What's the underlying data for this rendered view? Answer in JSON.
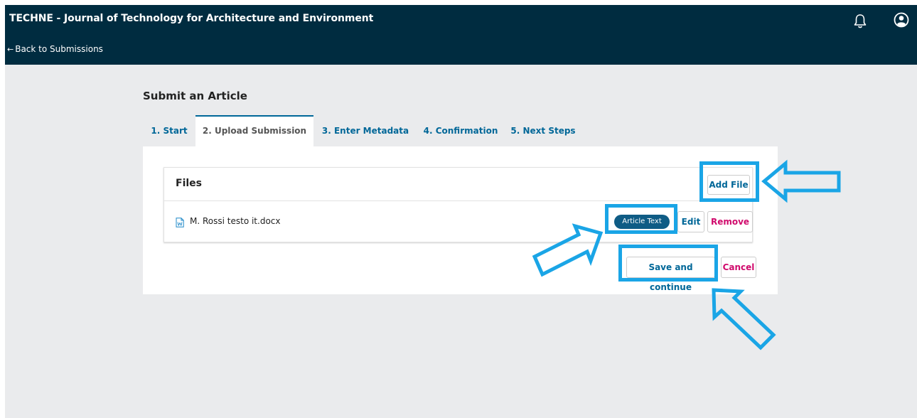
{
  "header": {
    "site_title": "TECHNE - Journal of Technology for Architecture and Environment",
    "back_link": "Back to Submissions",
    "back_arrow": "←"
  },
  "page": {
    "heading": "Submit an Article"
  },
  "tabs": [
    {
      "label": "1. Start",
      "active": false
    },
    {
      "label": "2. Upload Submission",
      "active": true
    },
    {
      "label": "3. Enter Metadata",
      "active": false
    },
    {
      "label": "4. Confirmation",
      "active": false
    },
    {
      "label": "5. Next Steps",
      "active": false
    }
  ],
  "files": {
    "title": "Files",
    "add_file_label": "Add File",
    "items": [
      {
        "name": "M. Rossi testo it.docx",
        "type_badge": "Article Text",
        "edit_label": "Edit",
        "remove_label": "Remove"
      }
    ]
  },
  "actions": {
    "save_label": "Save and continue",
    "cancel_label": "Cancel"
  },
  "colors": {
    "header_bg": "#002c40",
    "link": "#006798",
    "danger": "#d00a6c",
    "badge_bg": "#0f5c85",
    "annotation": "#1aa5e6",
    "page_bg": "#eaebed"
  },
  "icons": {
    "notifications": "bell-icon",
    "user": "user-circle-icon",
    "file": "word-document-icon"
  }
}
